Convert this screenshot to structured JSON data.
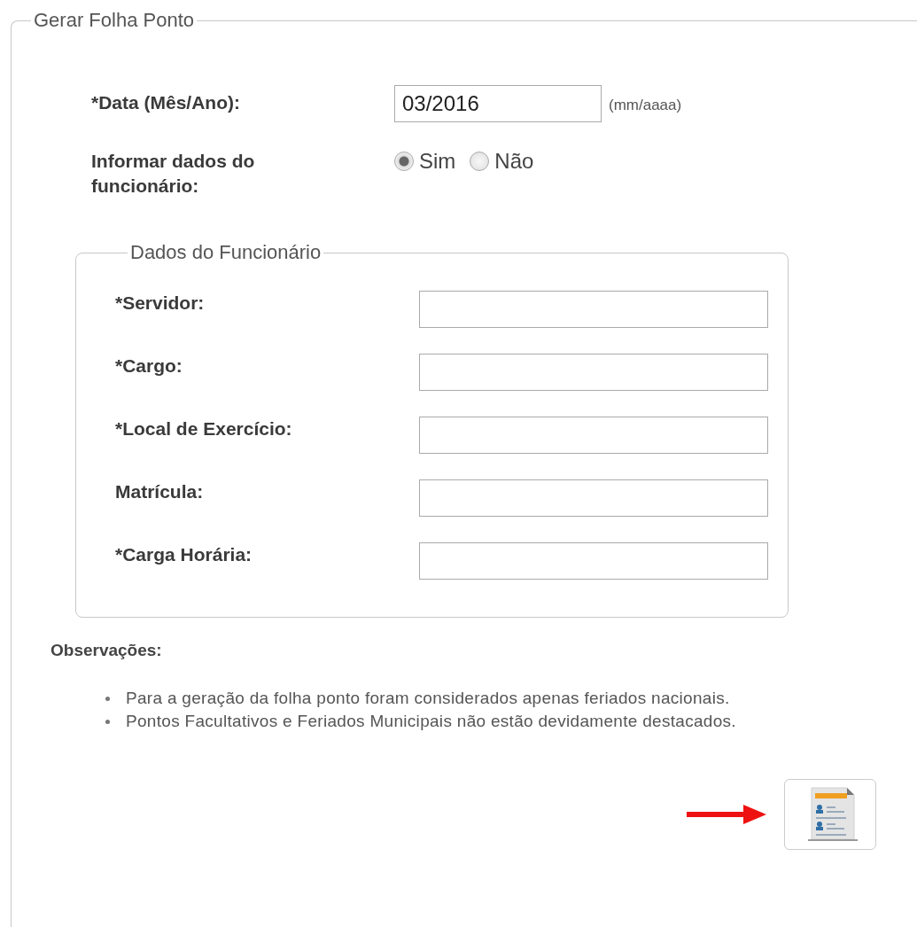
{
  "form": {
    "title": "Gerar Folha Ponto",
    "date_label": "*Data (Mês/Ano):",
    "date_value": "03/2016",
    "date_hint": "(mm/aaaa)",
    "employee_toggle_label": "Informar dados do funcionário:",
    "employee_toggle_options": [
      {
        "label": "Sim",
        "selected": true
      },
      {
        "label": "Não",
        "selected": false
      }
    ]
  },
  "employee_section": {
    "title": "Dados do Funcionário",
    "fields": [
      {
        "label": "*Servidor:"
      },
      {
        "label": "*Cargo:"
      },
      {
        "label": "*Local de Exercício:"
      },
      {
        "label": "Matrícula:"
      },
      {
        "label": "*Carga Horária:"
      }
    ]
  },
  "notes": {
    "title": "Observações:",
    "items": [
      "Para a geração da folha ponto foram considerados apenas feriados nacionais.",
      "Pontos Facultativos e Feriados Municipais não estão devidamente destacados."
    ]
  },
  "generate_button": {
    "annotated": true
  }
}
